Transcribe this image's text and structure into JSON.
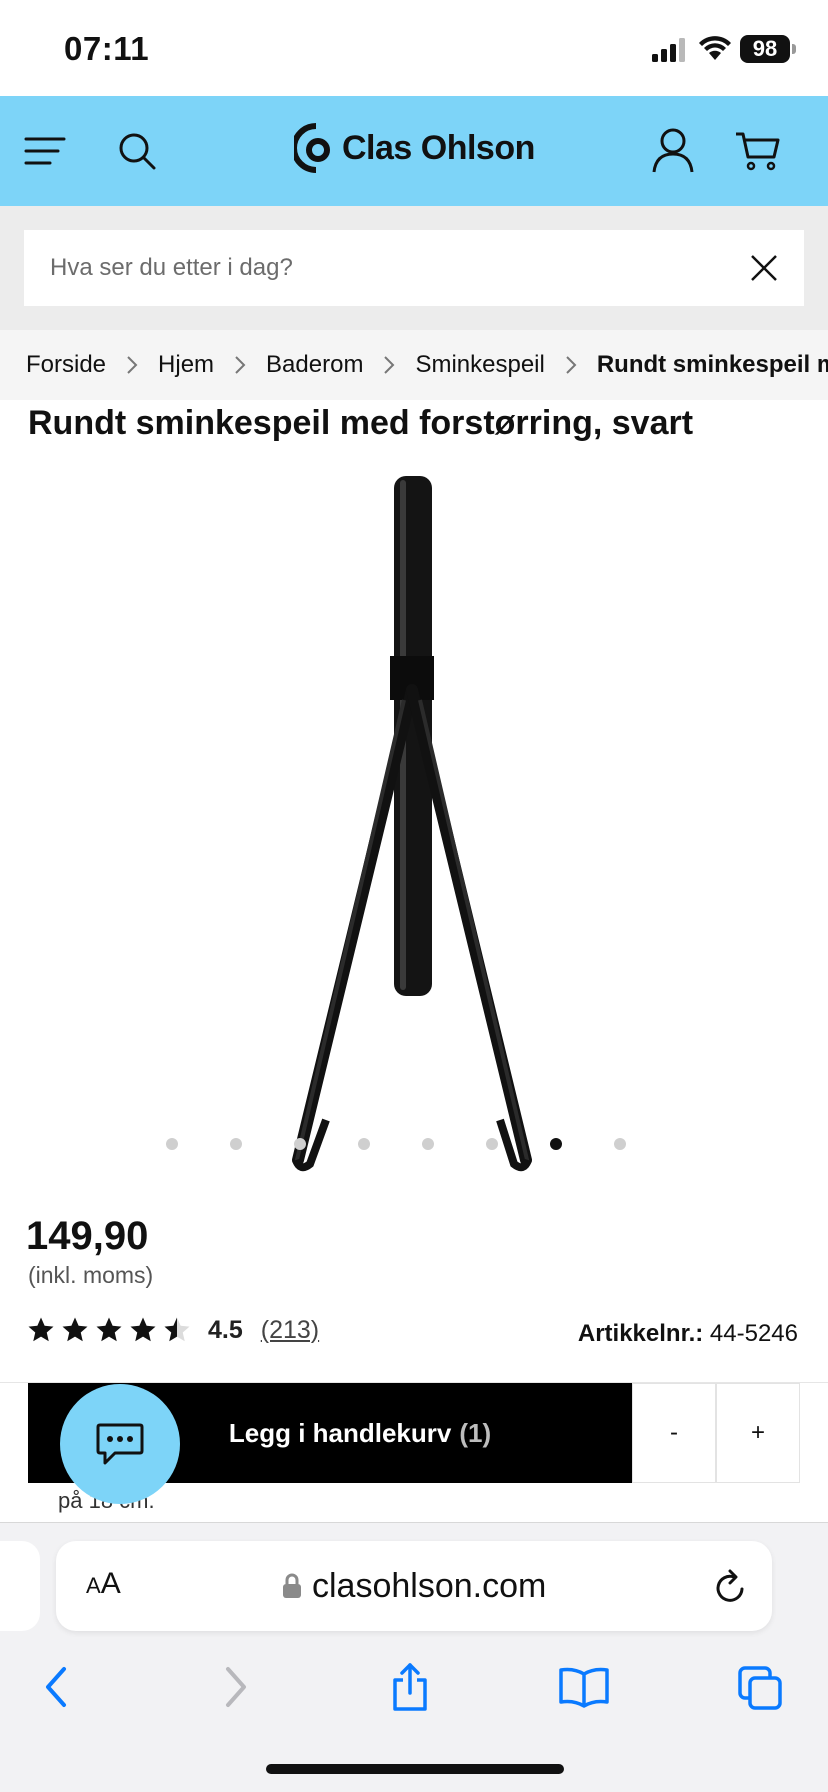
{
  "status_bar": {
    "time": "07:11",
    "battery": "98"
  },
  "header": {
    "brand": "Clas Ohlson"
  },
  "search": {
    "placeholder": "Hva ser du etter i dag?"
  },
  "breadcrumb": [
    "Forside",
    "Hjem",
    "Baderom",
    "Sminkespeil",
    "Rundt sminkespeil med forstørring, svart"
  ],
  "product": {
    "title": "Rundt sminkespeil med forstørring, svart",
    "image_dots": {
      "count": 8,
      "active_index": 6
    },
    "price": "149,90",
    "vat_note": "(inkl. moms)",
    "rating": {
      "value": "4.5",
      "count": "(213)",
      "stars": 4.5
    },
    "article_label": "Artikkelnr.:",
    "article_number": "44-5246",
    "description_fragment": "på 18 cm."
  },
  "cart": {
    "label": "Legg i handlekurv",
    "count": "(1)",
    "minus": "-",
    "plus": "+"
  },
  "safari": {
    "aa_small": "A",
    "aa_large": "A",
    "url": "clasohlson.com"
  },
  "colors": {
    "brand": "#7dd4f8",
    "cart_button": "#000000",
    "safari_blue": "#0a7aff"
  },
  "icons": [
    "menu-icon",
    "search-icon",
    "account-icon",
    "cart-icon",
    "close-icon",
    "chevron-right-icon",
    "star-icon",
    "chat-icon",
    "lock-icon",
    "reload-icon",
    "back-icon",
    "forward-icon",
    "share-icon",
    "bookmarks-icon",
    "tabs-icon"
  ]
}
